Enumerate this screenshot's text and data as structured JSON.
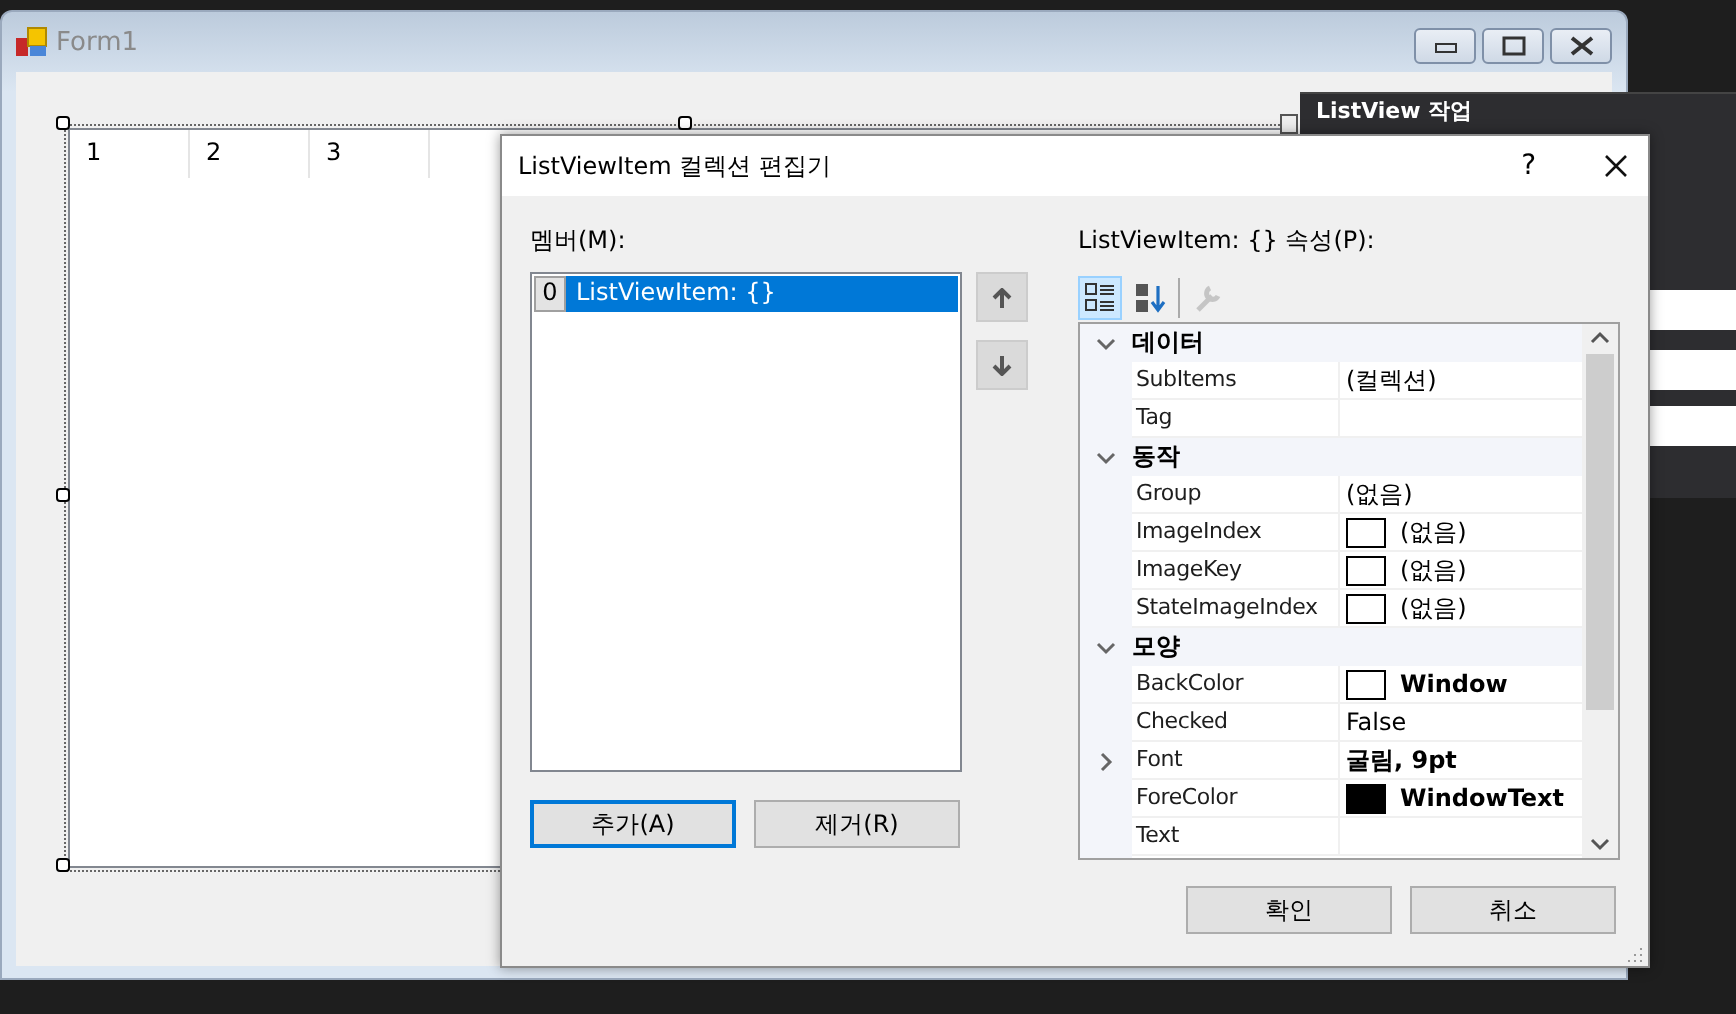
{
  "form": {
    "title": "Form1",
    "listview": {
      "columns": [
        "1",
        "2",
        "3"
      ]
    }
  },
  "smart_tag": {
    "title": "ListView 작업"
  },
  "dialog": {
    "title": "ListViewItem 컬렉션 편집기",
    "help": "?",
    "members": {
      "label": "멤버(M):",
      "items": [
        {
          "index": "0",
          "text": "ListViewItem: {}",
          "selected": true
        }
      ]
    },
    "member_buttons": [
      {
        "label": "추가(A)",
        "default": true
      },
      {
        "label": "제거(R)",
        "default": false
      }
    ],
    "properties": {
      "label": "ListViewItem: {} 속성(P):",
      "toolbar": [
        {
          "kind": "categorized",
          "selected": true,
          "disabled": false
        },
        {
          "kind": "alphabetical",
          "selected": false,
          "disabled": false
        },
        {
          "kind": "pages",
          "selected": false,
          "disabled": true
        }
      ],
      "categories": [
        {
          "name": "데이터",
          "expanded": true,
          "children": [
            {
              "name": "SubItems",
              "value": "(컬렉션)"
            },
            {
              "name": "Tag"
            }
          ]
        },
        {
          "name": "동작",
          "expanded": true,
          "children": [
            {
              "name": "Group",
              "value": "(없음)"
            },
            {
              "name": "ImageIndex",
              "value": "(없음)",
              "swatch": true
            },
            {
              "name": "ImageKey",
              "value": "(없음)",
              "swatch": true
            },
            {
              "name": "StateImageIndex",
              "value": "(없음)",
              "swatch": true
            }
          ]
        },
        {
          "name": "모양",
          "expanded": true,
          "children": [
            {
              "name": "BackColor",
              "value": "Window",
              "swatch": true,
              "color": "#ffffff",
              "bold": true
            },
            {
              "name": "Checked",
              "value": "False"
            },
            {
              "name": "Font",
              "value": "굴림, 9pt",
              "bold": true,
              "expanded": false
            },
            {
              "name": "ForeColor",
              "value": "WindowText",
              "swatch": true,
              "color": "#000000",
              "bold": true
            },
            {
              "name": "Text"
            }
          ]
        }
      ]
    },
    "buttons": [
      "확인",
      "취소"
    ]
  }
}
